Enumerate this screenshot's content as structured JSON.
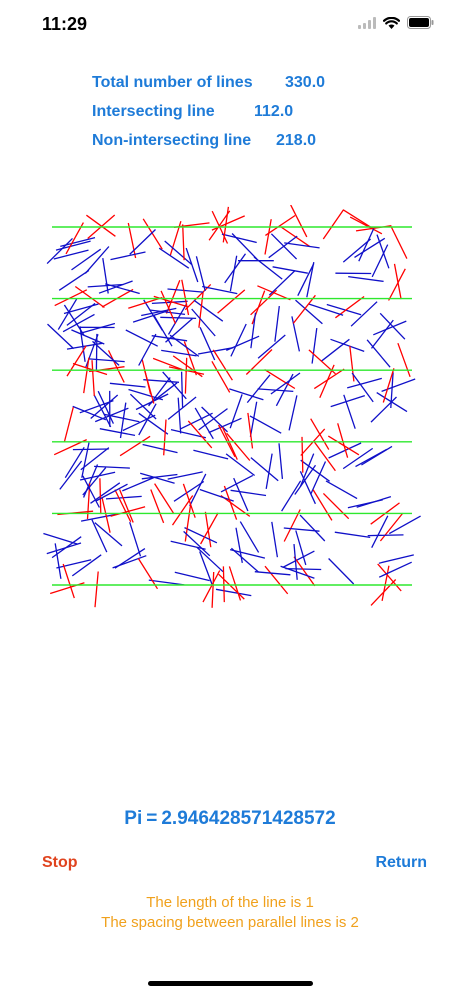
{
  "status_bar": {
    "time": "11:29"
  },
  "stats": [
    {
      "label": "Total number of lines",
      "value": "330.0"
    },
    {
      "label": "Intersecting line",
      "value": "112.0"
    },
    {
      "label": "Non-intersecting line",
      "value": "218.0"
    }
  ],
  "simulation": {
    "parallel_lines": 6,
    "parallel_line_color": "#2ee82e",
    "intersecting_color": "#ff0000",
    "non_intersecting_color": "#1010c8",
    "total_needles": 330,
    "intersecting_needles": 112
  },
  "result": {
    "prefix": "Pi",
    "equals": "=",
    "value": "2.946428571428572"
  },
  "buttons": {
    "stop": "Stop",
    "return": "Return"
  },
  "info": {
    "line1": "The length of the line is 1",
    "line2": "The spacing between parallel lines is 2"
  },
  "colors": {
    "accent": "#1e7bd8",
    "stop": "#e0431e",
    "info": "#f0a11d"
  }
}
